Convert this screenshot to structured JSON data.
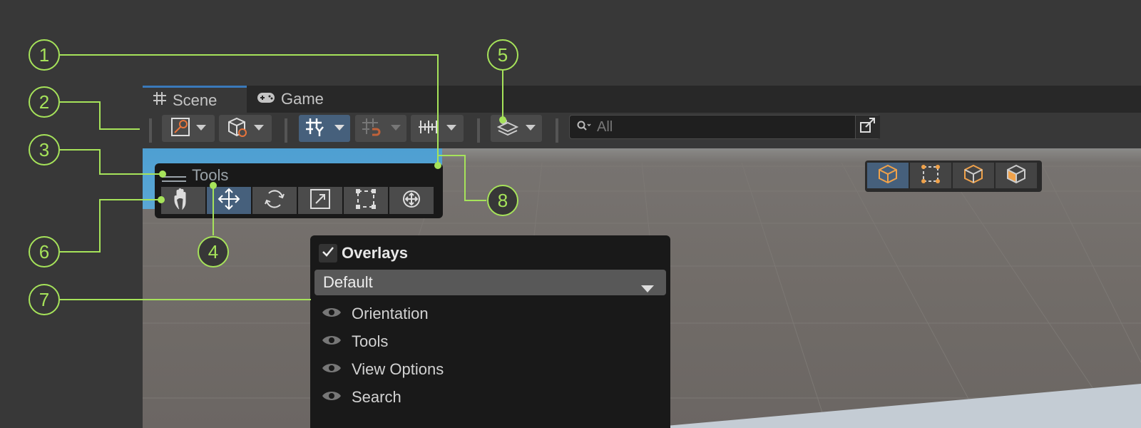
{
  "tabs": [
    {
      "label": "Scene",
      "icon": "grid-hash-icon",
      "active": true
    },
    {
      "label": "Game",
      "icon": "gamepad-icon",
      "active": false
    }
  ],
  "toolbar": {
    "search": {
      "placeholder": "All",
      "icon": "search-icon"
    },
    "buttons": [
      {
        "name": "draw-mode-button",
        "icon": "draw-mode-icon"
      },
      {
        "name": "scene-visibility-button",
        "icon": "cube-icon"
      },
      {
        "name": "grid-snap-button",
        "icon": "grid-y-icon",
        "selected": true
      },
      {
        "name": "increment-snap-button",
        "icon": "snap-magnet-icon"
      },
      {
        "name": "ruler-button",
        "icon": "ruler-icon"
      },
      {
        "name": "layers-button",
        "icon": "layers-icon"
      },
      {
        "name": "expand-button",
        "icon": "expand-icon"
      }
    ]
  },
  "tools_overlay": {
    "title": "Tools",
    "tools": [
      {
        "name": "hand-tool",
        "icon": "hand-icon"
      },
      {
        "name": "move-tool",
        "icon": "move-icon",
        "selected": true
      },
      {
        "name": "rotate-tool",
        "icon": "rotate-icon"
      },
      {
        "name": "scale-tool",
        "icon": "scale-icon"
      },
      {
        "name": "rect-tool",
        "icon": "rect-icon"
      },
      {
        "name": "transform-tool",
        "icon": "transform-icon"
      }
    ]
  },
  "orientation_buttons": [
    {
      "icon": "cube-icon",
      "selected": true
    },
    {
      "icon": "rect-icon"
    },
    {
      "icon": "cube-outline-icon"
    },
    {
      "icon": "cube-shaded-icon"
    }
  ],
  "overlays_menu": {
    "title": "Overlays",
    "checked": true,
    "preset": "Default",
    "items": [
      {
        "label": "Orientation",
        "visible": true
      },
      {
        "label": "Tools",
        "visible": true
      },
      {
        "label": "View Options",
        "visible": true
      },
      {
        "label": "Search",
        "visible": true
      }
    ]
  },
  "callouts": [
    "1",
    "2",
    "3",
    "4",
    "5",
    "6",
    "7",
    "8"
  ],
  "colors": {
    "accent": "#a6e35a",
    "selected": "#46607c",
    "tab_active": "#3a79bb"
  }
}
